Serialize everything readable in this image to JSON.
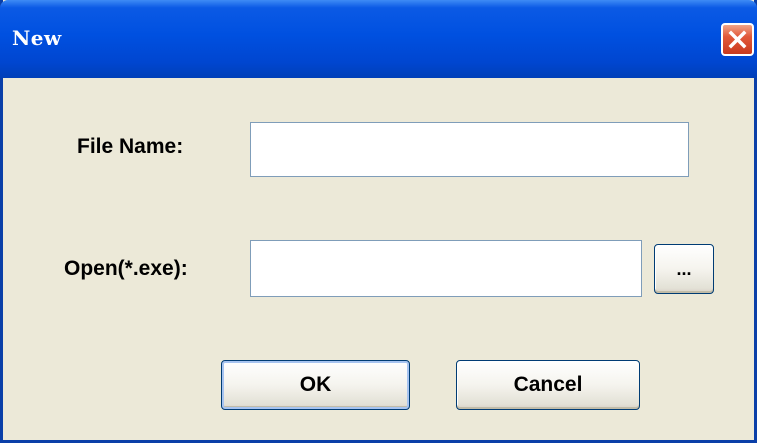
{
  "window": {
    "title": "New",
    "close_icon": "close-icon"
  },
  "form": {
    "file_name_label": "File Name:",
    "file_name_value": "",
    "open_label": "Open(*.exe):",
    "open_value": "",
    "browse_label": "..."
  },
  "buttons": {
    "ok_label": "OK",
    "cancel_label": "Cancel"
  },
  "colors": {
    "titlebar": "#0050E0",
    "dialog_background": "#ECE9D8",
    "close_button": "#E2593A",
    "input_border": "#7F9DB9"
  }
}
